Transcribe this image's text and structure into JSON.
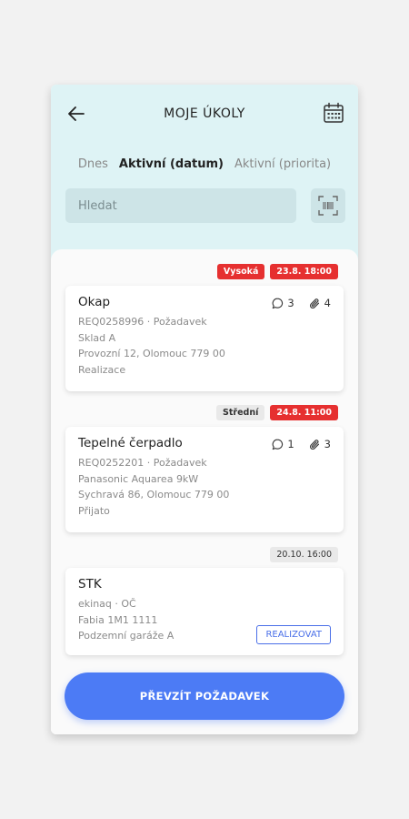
{
  "header": {
    "title": "MOJE ÚKOLY"
  },
  "tabs": [
    {
      "label": "Dnes",
      "active": false
    },
    {
      "label": "Aktivní (datum)",
      "active": true
    },
    {
      "label": "Aktivní (priorita)",
      "active": false
    }
  ],
  "search": {
    "placeholder": "Hledat"
  },
  "tasks": [
    {
      "priority": "Vysoká",
      "date": "23.8. 18:00",
      "title": "Okap",
      "lines": [
        "REQ0258996 · Požadavek",
        "Sklad A",
        "Provozní 12, Olomouc 779 00",
        "Realizace"
      ],
      "comments": "3",
      "attachments": "4"
    },
    {
      "priority": "Střední",
      "date": "24.8. 11:00",
      "title": "Tepelné čerpadlo",
      "lines": [
        "REQ0252201 · Požadavek",
        "Panasonic Aquarea 9kW",
        "Sychravá 86, Olomouc 779 00",
        "Přijato"
      ],
      "comments": "1",
      "attachments": "3"
    },
    {
      "date": "20.10. 16:00",
      "title": "STK",
      "lines": [
        "ekinaq · OČ",
        "Fabia 1M1 1111",
        "Podzemní garáže A"
      ],
      "action_label": "REALIZOVAT"
    }
  ],
  "primary_button": {
    "label": "PŘEVZÍT POŽADAVEK"
  },
  "colors": {
    "header_bg": "#def3f5",
    "accent": "#4c7bf5",
    "danger": "#e63030"
  }
}
